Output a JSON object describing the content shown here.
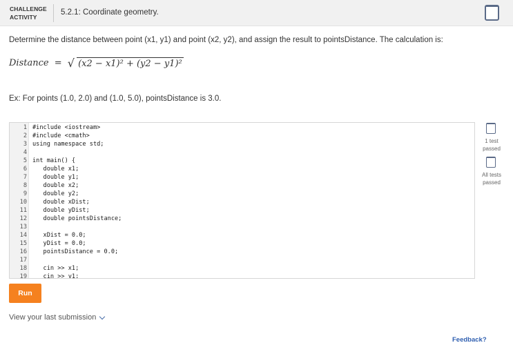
{
  "header": {
    "badge_line1": "CHALLENGE",
    "badge_line2": "ACTIVITY",
    "title": "5.2.1: Coordinate geometry."
  },
  "instruction": "Determine the distance between point (x1, y1) and point (x2, y2), and assign the result to pointsDistance. The calculation is:",
  "formula": {
    "lhs": "Distance",
    "eq": "=",
    "radical": "√",
    "radicand": "(x2 − x1)² + (y2 − y1)²"
  },
  "example": "Ex: For points (1.0, 2.0) and (1.0, 5.0), pointsDistance is 3.0.",
  "code": [
    {
      "n": "1",
      "t": "#include <iostream>"
    },
    {
      "n": "2",
      "t": "#include <cmath>"
    },
    {
      "n": "3",
      "t": "using namespace std;"
    },
    {
      "n": "4",
      "t": ""
    },
    {
      "n": "5",
      "t": "int main() {"
    },
    {
      "n": "6",
      "t": "   double x1;"
    },
    {
      "n": "7",
      "t": "   double y1;"
    },
    {
      "n": "8",
      "t": "   double x2;"
    },
    {
      "n": "9",
      "t": "   double y2;"
    },
    {
      "n": "10",
      "t": "   double xDist;"
    },
    {
      "n": "11",
      "t": "   double yDist;"
    },
    {
      "n": "12",
      "t": "   double pointsDistance;"
    },
    {
      "n": "13",
      "t": ""
    },
    {
      "n": "14",
      "t": "   xDist = 0.0;"
    },
    {
      "n": "15",
      "t": "   yDist = 0.0;"
    },
    {
      "n": "16",
      "t": "   pointsDistance = 0.0;"
    },
    {
      "n": "17",
      "t": ""
    },
    {
      "n": "18",
      "t": "   cin >> x1;"
    },
    {
      "n": "19",
      "t": "   cin >> y1;"
    }
  ],
  "side": {
    "test1": "1 test passed",
    "test_all": "All tests passed"
  },
  "run_label": "Run",
  "last_submission": "View your last submission",
  "feedback": "Feedback?"
}
